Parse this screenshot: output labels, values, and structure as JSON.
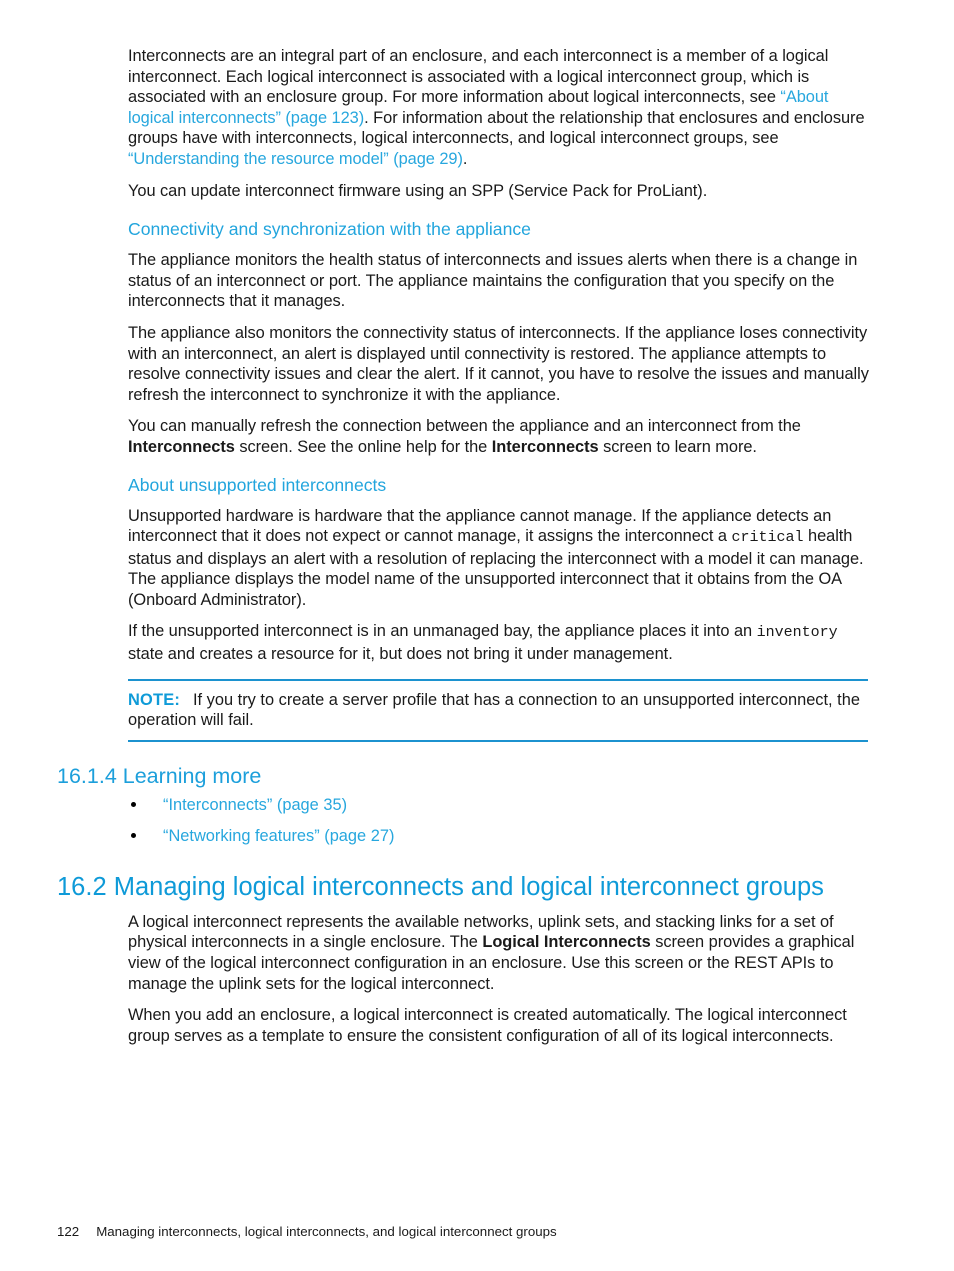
{
  "page": {
    "number": "122",
    "footer_title": "Managing interconnects, logical interconnects, and logical interconnect groups"
  },
  "intro": {
    "p1_a": "Interconnects are an integral part of an enclosure, and each interconnect is a member of a logical interconnect. Each logical interconnect is associated with a logical interconnect group, which is associated with an enclosure group. For more information about logical interconnects, see ",
    "p1_link1": "“About logical interconnects” (page 123)",
    "p1_b": ". For information about the relationship that enclosures and enclosure groups have with interconnects, logical interconnects, and logical interconnect groups, see ",
    "p1_link2": "“Understanding the resource model” (page 29)",
    "p1_c": ".",
    "p2": "You can update interconnect firmware using an SPP (Service Pack for ProLiant)."
  },
  "connectivity": {
    "heading": "Connectivity and synchronization with the appliance",
    "p1": "The appliance monitors the health status of interconnects and issues alerts when there is a change in status of an interconnect or port. The appliance maintains the configuration that you specify on the interconnects that it manages.",
    "p2": "The appliance also monitors the connectivity status of interconnects. If the appliance loses connectivity with an interconnect, an alert is displayed until connectivity is restored. The appliance attempts to resolve connectivity issues and clear the alert. If it cannot, you have to resolve the issues and manually refresh the interconnect to synchronize it with the appliance.",
    "p3_a": "You can manually refresh the connection between the appliance and an interconnect from the ",
    "p3_bold1": "Interconnects",
    "p3_b": " screen. See the online help for the ",
    "p3_bold2": "Interconnects",
    "p3_c": " screen to learn more."
  },
  "unsupported": {
    "heading": "About unsupported interconnects",
    "p1_a": "Unsupported hardware is hardware that the appliance cannot manage. If the appliance detects an interconnect that it does not expect or cannot manage, it assigns the interconnect a ",
    "p1_mono": "critical",
    "p1_b": " health status and displays an alert with a resolution of replacing the interconnect with a model it can manage. The appliance displays the model name of the unsupported interconnect that it obtains from the OA (Onboard Administrator).",
    "p2_a": "If the unsupported interconnect is in an unmanaged bay, the appliance places it into an ",
    "p2_mono": "inventory",
    "p2_b": " state and creates a resource for it, but does not bring it under management."
  },
  "note": {
    "label": "NOTE:",
    "text": "If you try to create a server profile that has a connection to an unsupported interconnect, the operation will fail."
  },
  "learning_more": {
    "heading": "16.1.4 Learning more",
    "links": [
      "“Interconnects” (page 35)",
      "“Networking features” (page 27)"
    ]
  },
  "managing": {
    "heading": "16.2 Managing logical interconnects and logical interconnect groups",
    "p1_a": "A logical interconnect represents the available networks, uplink sets, and stacking links for a set of physical interconnects in a single enclosure. The ",
    "p1_bold": "Logical Interconnects",
    "p1_b": " screen provides a graphical view of the logical interconnect configuration in an enclosure. Use this screen or the REST APIs to manage the uplink sets for the logical interconnect.",
    "p2": "When you add an enclosure, a logical interconnect is created automatically. The logical interconnect group serves as a template to ensure the consistent configuration of all of its logical interconnects."
  },
  "colors": {
    "link": "#27a7de",
    "subheading": "#22a5dd",
    "section_heading": "#0e9ad8",
    "note_rule": "#1c92cf",
    "body_text": "#1a1a1a"
  }
}
